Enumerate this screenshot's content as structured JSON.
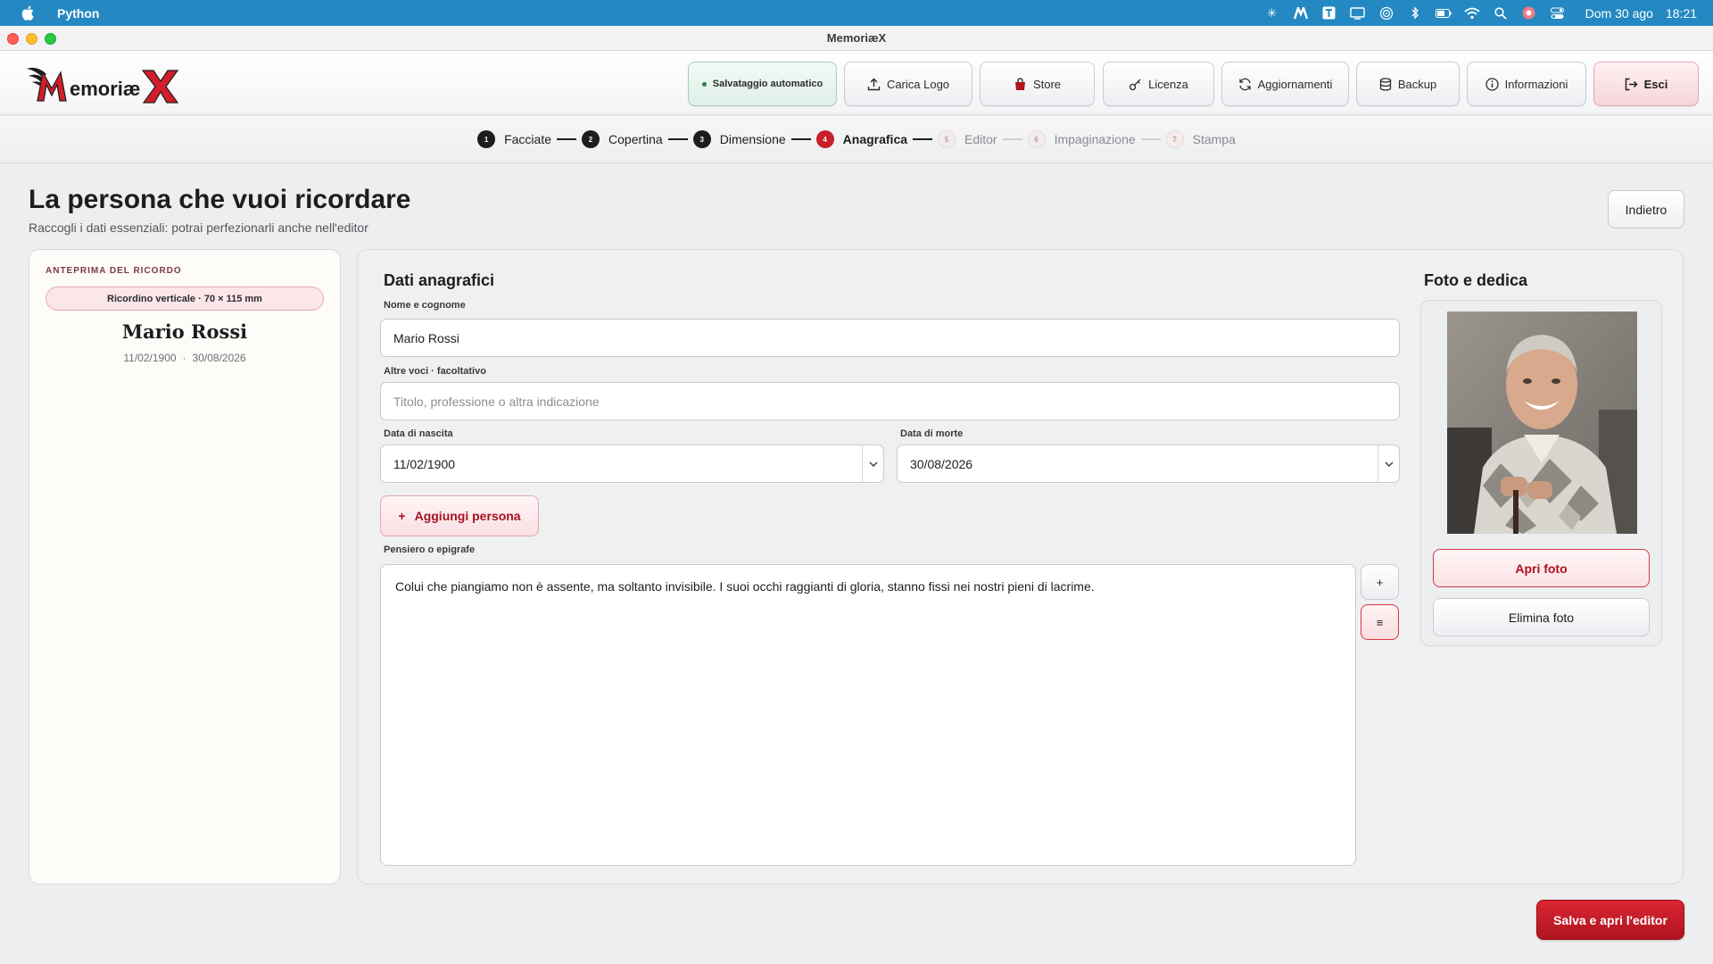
{
  "menubar": {
    "app_name": "Python",
    "date": "Dom 30 ago",
    "time": "18:21"
  },
  "window": {
    "title": "MemoriæX"
  },
  "header": {
    "logo_text": "MemoriæX",
    "autosave": "Salvataggio automatico",
    "buttons": {
      "upload_logo": "Carica Logo",
      "store": "Store",
      "license": "Licenza",
      "updates": "Aggiornamenti",
      "backup": "Backup",
      "info": "Informazioni",
      "exit": "Esci"
    }
  },
  "stepper": {
    "steps": [
      {
        "num": "1",
        "label": "Facciate"
      },
      {
        "num": "2",
        "label": "Copertina"
      },
      {
        "num": "3",
        "label": "Dimensione"
      },
      {
        "num": "4",
        "label": "Anagrafica"
      },
      {
        "num": "5",
        "label": "Editor"
      },
      {
        "num": "6",
        "label": "Impaginazione"
      },
      {
        "num": "7",
        "label": "Stampa"
      }
    ]
  },
  "page": {
    "title": "La persona che vuoi ricordare",
    "subtitle": "Raccogli i dati essenziali: potrai perfezionarli anche nell'editor",
    "back": "Indietro"
  },
  "preview": {
    "caption": "ANTEPRIMA DEL RICORDO",
    "format": "Ricordino verticale · 70 × 115 mm",
    "name": "Mario Rossi",
    "birth": "11/02/1900",
    "separator": "·",
    "death": "30/08/2026"
  },
  "form": {
    "title": "Dati anagrafici",
    "name_label": "Nome e cognome",
    "name_value": "Mario Rossi",
    "other_label": "Altre voci · facoltativo",
    "other_placeholder": "Titolo, professione o altra indicazione",
    "birth_label": "Data di nascita",
    "birth_value": "11/02/1900",
    "death_label": "Data di morte",
    "death_value": "30/08/2026",
    "add_person": "Aggiungi persona",
    "add_person_icon": "+",
    "epigraph_label": "Pensiero o epigrafe",
    "epigraph_value": "Colui che piangiamo non è assente, ma soltanto invisibile. I suoi occhi raggianti di gloria, stanno fissi nei nostri pieni di lacrime.",
    "epigraph_add": "+",
    "epigraph_list": "≡"
  },
  "photo": {
    "title": "Foto e dedica",
    "open": "Apri foto",
    "delete": "Elimina foto"
  },
  "footer": {
    "save": "Salva e apri l'editor"
  }
}
